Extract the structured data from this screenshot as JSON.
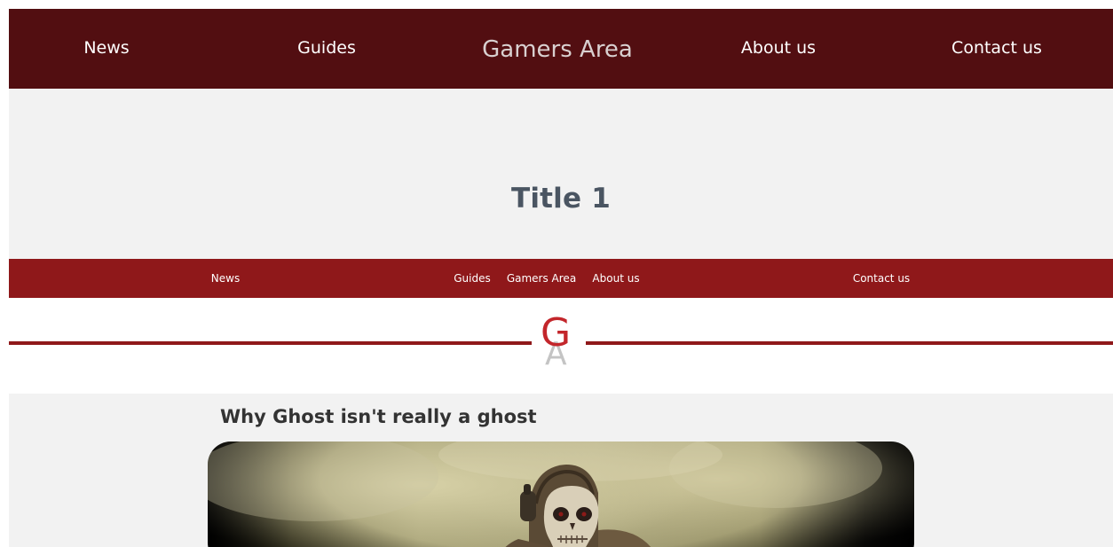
{
  "top_nav": {
    "items": [
      {
        "label": "News"
      },
      {
        "label": "Guides"
      },
      {
        "label": "Gamers Area"
      },
      {
        "label": "About us"
      },
      {
        "label": "Contact us"
      }
    ]
  },
  "hero": {
    "title": "Title 1"
  },
  "sub_nav": {
    "items": [
      {
        "label": "News"
      },
      {
        "label": "Guides"
      },
      {
        "label": "Gamers Area"
      },
      {
        "label": "About us"
      },
      {
        "label": "Contact us"
      }
    ]
  },
  "logo": {
    "letter_g": "G",
    "letter_a": "A"
  },
  "article": {
    "title": "Why Ghost isn't really a ghost",
    "image_icon": "soldier-skull-mask-image"
  },
  "colors": {
    "top_nav_bg": "#520e11",
    "sub_nav_bg": "#8f181a",
    "logo_red": "#c3262b",
    "hero_bg": "#f2f2f2",
    "title_text": "#4a5562"
  }
}
